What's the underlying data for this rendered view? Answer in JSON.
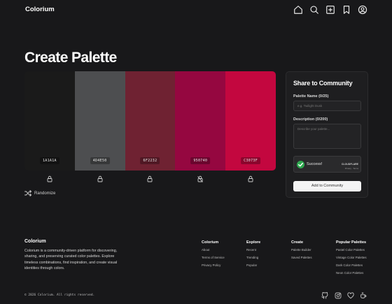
{
  "header": {
    "brand": "Colorium",
    "nav_icons": [
      "home-icon",
      "search-icon",
      "add-icon",
      "bookmark-icon",
      "account-icon"
    ]
  },
  "page_title": "Create Palette",
  "palette": {
    "swatches": [
      {
        "hex": "1A1A1A",
        "color": "#1a1a1a",
        "locked": true
      },
      {
        "hex": "4D4E50",
        "color": "#4d4e50",
        "locked": true
      },
      {
        "hex": "6F2232",
        "color": "#6f2232",
        "locked": true
      },
      {
        "hex": "950740",
        "color": "#950740",
        "locked": false
      },
      {
        "hex": "C3073F",
        "color": "#c3073f",
        "locked": true
      }
    ],
    "randomize_label": "Randomize"
  },
  "share": {
    "title": "Share to Community",
    "name_label": "Palette Name (0/25)",
    "name_placeholder": "e.g. Twilight Dusk",
    "desc_label": "Description (0/200)",
    "desc_placeholder": "Describe your palette...",
    "captcha_status": "Success!",
    "captcha_brand": "CLOUDFLARE",
    "captcha_sub": "Privacy · Terms",
    "submit_label": "Add to Community"
  },
  "footer": {
    "brand": "Colorium",
    "description": "Colorium is a community-driven platform for discovering, sharing, and preserving curated color palettes. Explore timeless combinations, find inspiration, and create visual identities through colors.",
    "columns": [
      {
        "title": "Colorium",
        "links": [
          "About",
          "Terms of Service",
          "Privacy Policy"
        ]
      },
      {
        "title": "Explore",
        "links": [
          "Recent",
          "Trending",
          "Popular"
        ]
      },
      {
        "title": "Create",
        "links": [
          "Palette Builder",
          "Saved Palettes"
        ]
      },
      {
        "title": "Popular Palettes",
        "links": [
          "Pastel Color Palettes",
          "Vintage Color Palettes",
          "Dark Color Palettes",
          "Neon Color Palettes"
        ]
      }
    ],
    "copyright": "© 2026 Colorium. All rights reserved.",
    "social_icons": [
      "github-icon",
      "instagram-icon",
      "heart-icon",
      "coffee-icon"
    ]
  }
}
